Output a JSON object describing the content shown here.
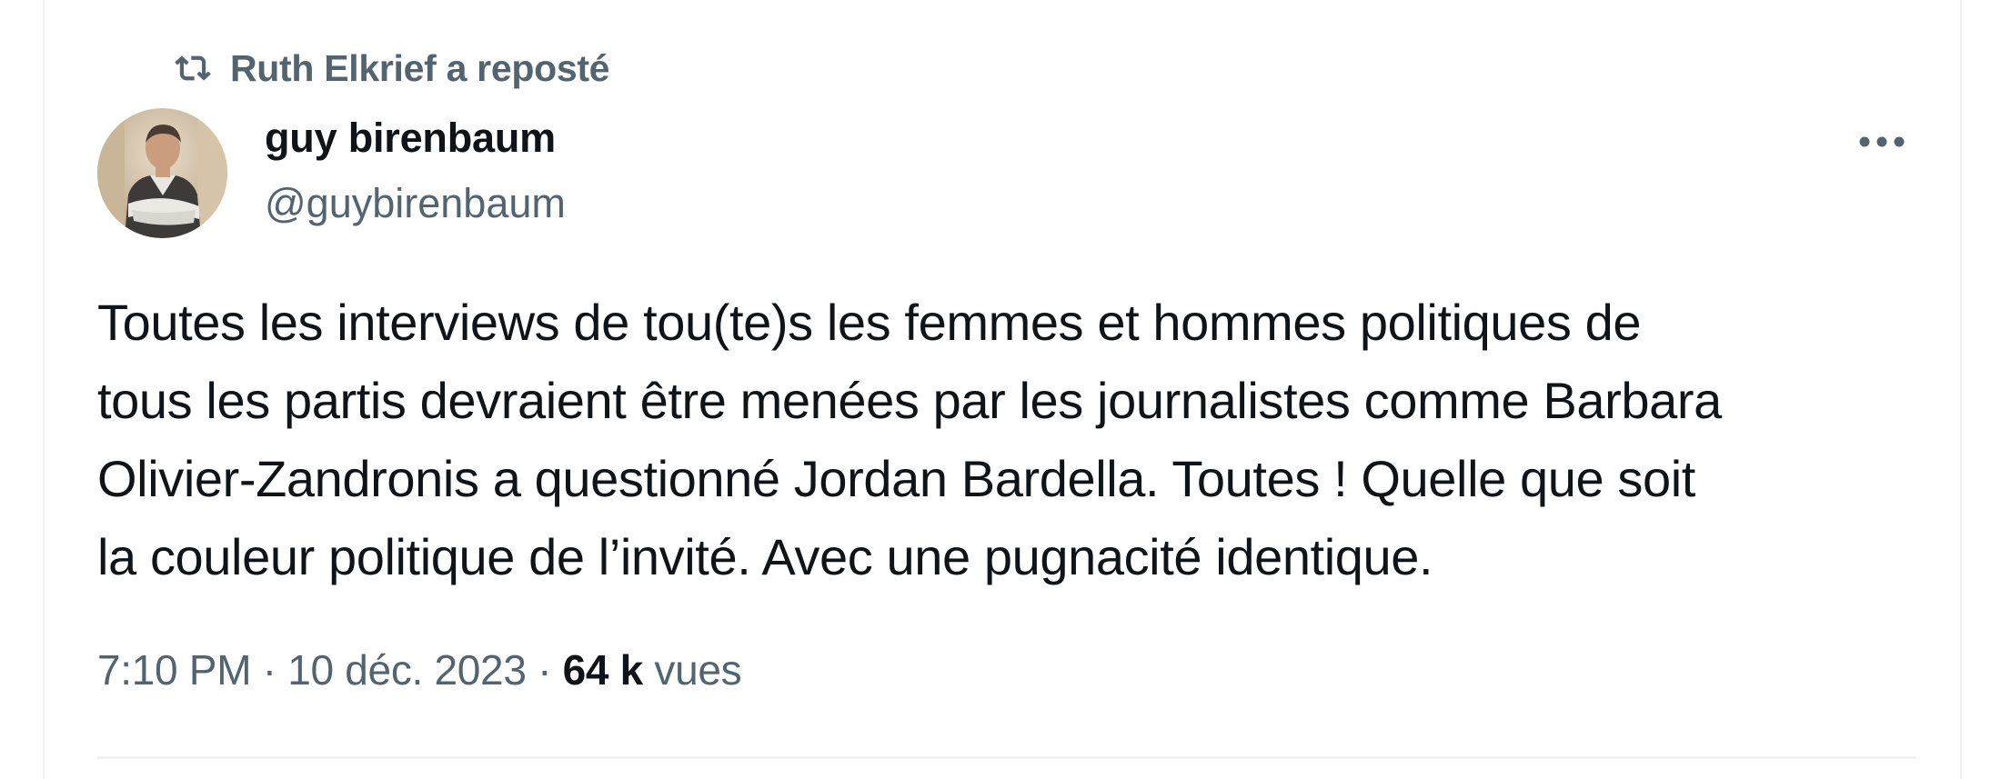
{
  "social_context": {
    "icon": "repost-icon",
    "label": "Ruth Elkrief a reposté"
  },
  "author": {
    "display_name": "guy birenbaum",
    "handle": "@guybirenbaum",
    "avatar_icon": "avatar"
  },
  "more_menu": {
    "icon": "more-icon"
  },
  "tweet": {
    "text_lines": [
      "Toutes les interviews de tou(te)s les femmes et hommes politiques de",
      "tous les partis devraient être menées par les journalistes comme Barbara",
      "Olivier-Zandronis a questionné Jordan Bardella. Toutes ! Quelle que soit",
      "la couleur politique de l’invité. Avec une pugnacité identique."
    ]
  },
  "meta": {
    "time": "7:10 PM",
    "separator": " · ",
    "date": "10 déc. 2023",
    "separator2": " · ",
    "views_count": "64 k",
    "views_label": " vues"
  },
  "colors": {
    "text_primary": "#0f1419",
    "text_secondary": "#536471",
    "border": "#eff3f4"
  }
}
